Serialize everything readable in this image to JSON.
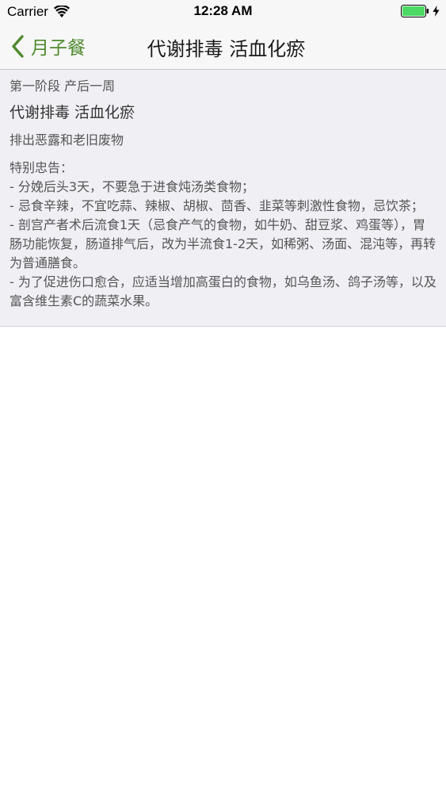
{
  "status_bar": {
    "carrier": "Carrier",
    "time": "12:28 AM",
    "wifi_icon": "wifi-icon",
    "battery_icon": "battery-full-icon",
    "charging_icon": "charging-bolt-icon"
  },
  "nav": {
    "back_label": "月子餐",
    "back_icon": "chevron-left-icon",
    "title": "代谢排毒 活血化瘀"
  },
  "content": {
    "stage": "第一阶段 产后一周",
    "title": "代谢排毒 活血化瘀",
    "subtitle": "排出恶露和老旧废物",
    "advice_heading": "特别忠告：",
    "advice_items": [
      " - 分娩后头3天，不要急于进食炖汤类食物；",
      " - 忌食辛辣，不宜吃蒜、辣椒、胡椒、茴香、韭菜等刺激性食物，忌饮茶；",
      " - 剖宫产者术后流食1天（忌食产气的食物，如牛奶、甜豆浆、鸡蛋等），胃肠功能恢复，肠道排气后，改为半流食1-2天，如稀粥、汤面、混沌等，再转为普通膳食。",
      " - 为了促进伤口愈合，应适当增加高蛋白的食物，如乌鱼汤、鸽子汤等，以及富含维生素C的蔬菜水果。"
    ]
  },
  "colors": {
    "accent": "#4f8a2e",
    "nav_background": "#f7f7f7",
    "card_background": "#efeff4",
    "battery": "#4cd964"
  }
}
